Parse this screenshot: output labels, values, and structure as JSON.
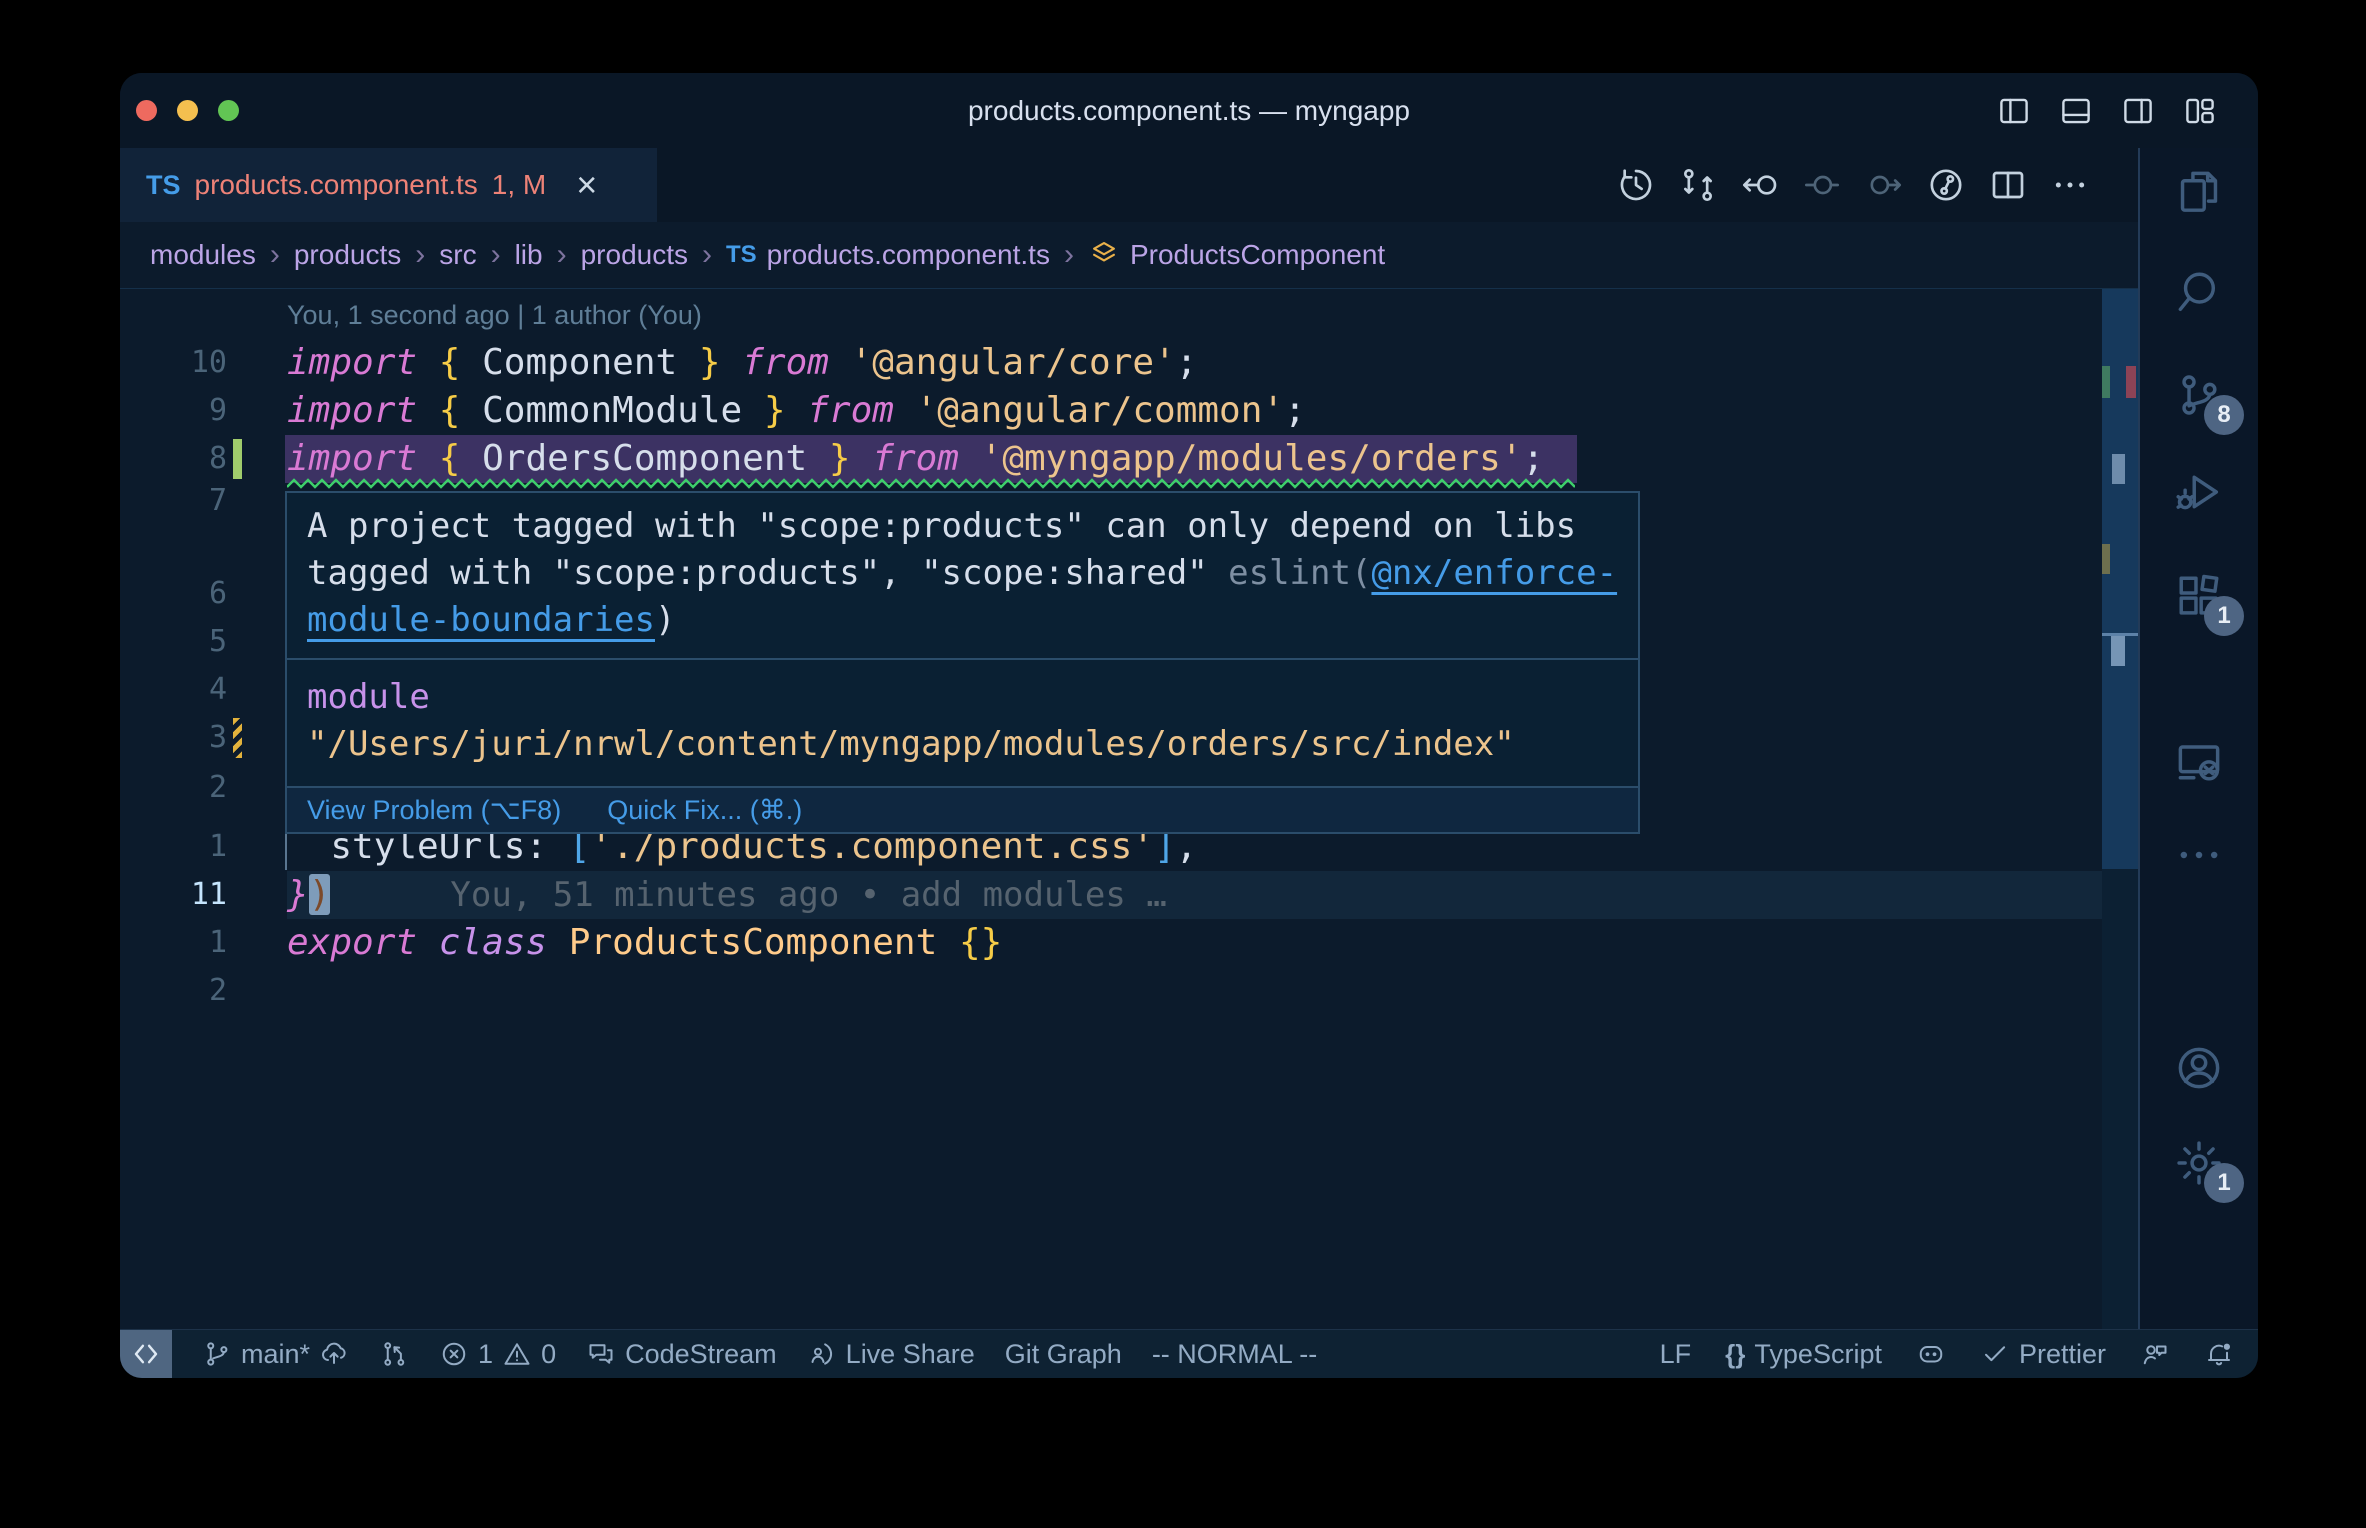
{
  "window": {
    "title": "products.component.ts — myngapp"
  },
  "titlebar_layout_icons": [
    "layout-sidebar-left-icon",
    "layout-panel-icon",
    "layout-sidebar-right-icon",
    "customize-layout-icon"
  ],
  "tab": {
    "ts_badge": "TS",
    "label": "products.component.ts",
    "decoration": "1, M",
    "close": "×"
  },
  "editor_toolbar": [
    {
      "icon": "history-icon",
      "dim": false
    },
    {
      "icon": "git-compare-icon",
      "dim": false
    },
    {
      "icon": "back-arrow-icon",
      "dim": false
    },
    {
      "icon": "prev-change-icon",
      "dim": true
    },
    {
      "icon": "next-change-icon",
      "dim": true
    },
    {
      "icon": "commit-graph-icon",
      "dim": false
    },
    {
      "icon": "split-editor-icon",
      "dim": false
    },
    {
      "icon": "more-actions-icon",
      "dim": false
    }
  ],
  "breadcrumb": {
    "separator": "›",
    "items": [
      {
        "label": "modules"
      },
      {
        "label": "products"
      },
      {
        "label": "src"
      },
      {
        "label": "lib"
      },
      {
        "label": "products"
      },
      {
        "label": "products.component.ts",
        "icon": "ts"
      },
      {
        "label": "ProductsComponent",
        "icon": "class"
      }
    ]
  },
  "code": {
    "blame_lens": "You, 1 second ago | 1 author (You)",
    "rows": [
      {
        "kind": "blame"
      },
      {
        "kind": "code",
        "num": "10",
        "tokens": [
          [
            "import",
            "kw"
          ],
          [
            " ",
            "fg"
          ],
          [
            "{",
            "br"
          ],
          [
            " Component ",
            "fg"
          ],
          [
            "}",
            "br"
          ],
          [
            " ",
            "fg"
          ],
          [
            "from",
            "kw"
          ],
          [
            " ",
            "fg"
          ],
          [
            "'@angular/core'",
            "str"
          ],
          [
            ";",
            "fg"
          ]
        ]
      },
      {
        "kind": "code",
        "num": "9",
        "tokens": [
          [
            "import",
            "kw"
          ],
          [
            " ",
            "fg"
          ],
          [
            "{",
            "br"
          ],
          [
            " CommonModule ",
            "fg"
          ],
          [
            "}",
            "br"
          ],
          [
            " ",
            "fg"
          ],
          [
            "from",
            "kw"
          ],
          [
            " ",
            "fg"
          ],
          [
            "'@angular/common'",
            "str"
          ],
          [
            ";",
            "fg"
          ]
        ]
      },
      {
        "kind": "code",
        "num": "8",
        "selected": true,
        "squiggle": true,
        "gutter": "added",
        "tokens": [
          [
            "import",
            "kw"
          ],
          [
            " ",
            "fg"
          ],
          [
            "{",
            "br"
          ],
          [
            " OrdersComponent ",
            "fg"
          ],
          [
            "}",
            "br"
          ],
          [
            " ",
            "fg"
          ],
          [
            "from",
            "kw"
          ],
          [
            " ",
            "fg"
          ],
          [
            "'@myngapp/modules/orders'",
            "str"
          ],
          [
            ";",
            "fg"
          ]
        ]
      },
      {
        "kind": "gutter",
        "num": "7"
      },
      {
        "kind": "gutter",
        "num": ""
      },
      {
        "kind": "gutter",
        "num": "6"
      },
      {
        "kind": "gutter",
        "num": "5"
      },
      {
        "kind": "gutter",
        "num": "4"
      },
      {
        "kind": "gutter",
        "num": "3",
        "gutter": "modified"
      },
      {
        "kind": "gutter",
        "num": "2"
      },
      {
        "kind": "code",
        "num": "1",
        "tokens": [
          [
            "  styleUrls: ",
            "fg"
          ],
          [
            "[",
            "brk"
          ],
          [
            "'./products.component.css'",
            "str"
          ],
          [
            "]",
            "brk"
          ],
          [
            ",",
            "fg"
          ]
        ]
      },
      {
        "kind": "code",
        "num": "11",
        "current": true,
        "blame": "You, 51 minutes ago • add modules …",
        "tokens": [
          [
            "}",
            "kw"
          ],
          [
            ")",
            "cursor"
          ]
        ]
      },
      {
        "kind": "code",
        "num": "1",
        "tokens": [
          [
            "export",
            "kw"
          ],
          [
            " ",
            "fg"
          ],
          [
            "class",
            "kw2"
          ],
          [
            " ",
            "fg"
          ],
          [
            "ProductsComponent",
            "cls"
          ],
          [
            " ",
            "fg"
          ],
          [
            "{}",
            "br"
          ]
        ]
      },
      {
        "kind": "gutter",
        "num": "2"
      }
    ]
  },
  "tooltip": {
    "message_line1": "A project tagged with \"scope:products\" can only depend on libs",
    "message_line2_pre": "tagged with \"scope:products\", \"scope:shared\" ",
    "message_line2_dim": "eslint(",
    "message_line2_link": "@nx/enforce-",
    "message_line3_link": "module-boundaries",
    "message_line3_post": ")",
    "module_label": "module",
    "module_path": "\"/Users/juri/nrwl/content/myngapp/modules/orders/src/index\"",
    "actions": [
      {
        "label": "View Problem (⌥F8)",
        "name": "view-problem-action"
      },
      {
        "label": "Quick Fix... (⌘.)",
        "name": "quick-fix-action"
      }
    ]
  },
  "activity_bar": [
    {
      "icon": "files-icon",
      "name": "activity-explorer"
    },
    {
      "icon": "search-icon",
      "name": "activity-search"
    },
    {
      "icon": "source-control-icon",
      "name": "activity-source-control",
      "badge": "8"
    },
    {
      "icon": "run-debug-icon",
      "name": "activity-run-debug"
    },
    {
      "icon": "extensions-icon",
      "name": "activity-extensions",
      "badge": "1"
    },
    {
      "icon": "remote-explorer-icon",
      "name": "activity-remote-explorer"
    },
    {
      "icon": "more-icon",
      "name": "activity-more"
    },
    {
      "icon": "account-icon",
      "name": "activity-account"
    },
    {
      "icon": "settings-gear-icon",
      "name": "activity-settings",
      "badge": "1"
    }
  ],
  "statusbar": {
    "left": [
      {
        "name": "remote-indicator",
        "remote": true,
        "parts": [
          {
            "icon": "remote-icon"
          }
        ]
      },
      {
        "name": "branch-status",
        "parts": [
          {
            "icon": "git-branch-icon"
          },
          {
            "text": "main*"
          },
          {
            "icon": "cloud-upload-icon"
          }
        ]
      },
      {
        "name": "commit-graph-status",
        "parts": [
          {
            "icon": "commit-node-icon"
          }
        ]
      },
      {
        "name": "problems-status",
        "parts": [
          {
            "icon": "error-circle-icon"
          },
          {
            "text": "1"
          },
          {
            "icon": "warning-triangle-icon"
          },
          {
            "text": "0"
          }
        ]
      },
      {
        "name": "codestream-status",
        "parts": [
          {
            "icon": "comment-discussion-icon"
          },
          {
            "text": "CodeStream"
          }
        ]
      },
      {
        "name": "live-share-status",
        "parts": [
          {
            "icon": "live-share-icon"
          },
          {
            "text": "Live Share"
          }
        ]
      },
      {
        "name": "git-graph-status",
        "parts": [
          {
            "text": "Git Graph"
          }
        ]
      },
      {
        "name": "vim-mode-status",
        "parts": [
          {
            "text": "-- NORMAL --"
          }
        ]
      }
    ],
    "right": [
      {
        "name": "eol-status",
        "parts": [
          {
            "text": "LF"
          }
        ]
      },
      {
        "name": "language-status",
        "parts": [
          {
            "txt_icon": "{}"
          },
          {
            "text": "TypeScript"
          }
        ]
      },
      {
        "name": "copilot-status",
        "parts": [
          {
            "icon": "copilot-icon"
          }
        ]
      },
      {
        "name": "prettier-status",
        "parts": [
          {
            "icon": "check-icon"
          },
          {
            "text": "Prettier"
          }
        ]
      },
      {
        "name": "feedback-status",
        "parts": [
          {
            "icon": "person-feedback-icon"
          }
        ]
      },
      {
        "name": "notifications-status",
        "parts": [
          {
            "icon": "bell-dot-icon"
          }
        ]
      }
    ]
  },
  "colors": {
    "editor_bg": "#0c1b2c",
    "chrome_bg": "#0a1726",
    "tab_active_bg": "#112339",
    "statusbar_bg": "#0e2233",
    "activity_bg": "#0a1728",
    "tab_error_label": "#ee8277",
    "link_blue": "#459ce8",
    "breadcrumb": "#bba4e6",
    "keyword": "#d97ad4",
    "keyword2": "#c792ea",
    "string": "#ecc48d",
    "brace": "#f6cc47",
    "bracket": "#4fa6e8",
    "class_name": "#ffcb8b",
    "foreground": "#d6deeb",
    "line_number": "#4b6479",
    "line_number_active": "#c5e4fd",
    "blame": "#5f7e97",
    "selection": "#3c3263",
    "squiggle": "#3ecf6b",
    "gutter_added": "#a0cc6c",
    "gutter_modified": "#e2b23c",
    "traffic_red": "#ee6a5f",
    "traffic_yellow": "#f4bf4f",
    "traffic_green": "#62c554"
  }
}
